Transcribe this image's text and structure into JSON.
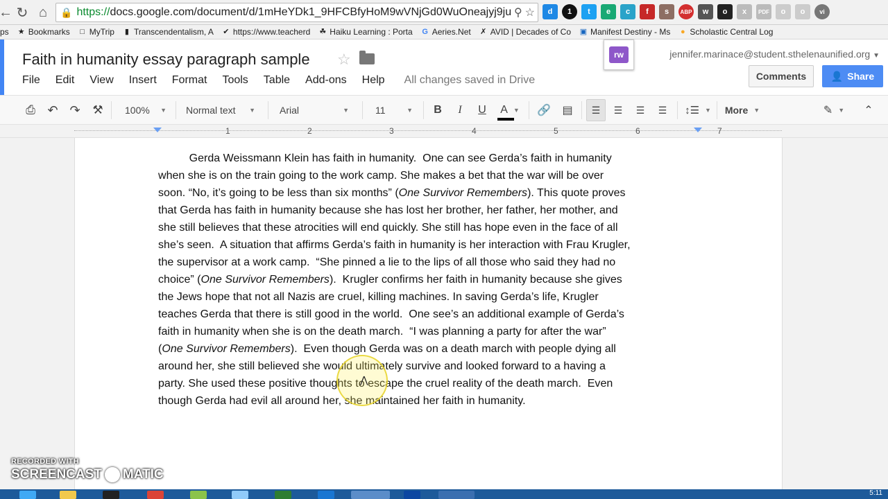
{
  "browser": {
    "url_scheme": "https://",
    "url_rest": "docs.google.com/document/d/1mHeYDk1_9HFCBfyHoM9wVNjGd0WuOneajyj9ju",
    "extensions": [
      "d",
      "1",
      "t",
      "e",
      "c",
      "f",
      "s",
      "ABP",
      "w",
      "o",
      "x",
      "PDF",
      "o",
      "o",
      "vi"
    ]
  },
  "bookmarks": {
    "cut": "ps",
    "items": [
      "Bookmarks",
      "MyTrip",
      "Transcendentalism, A",
      "https://www.teacherd",
      "Haiku Learning : Porta",
      "Aeries.Net",
      "AVID | Decades of Co",
      "Manifest Destiny - Ms",
      "Scholastic Central Log"
    ]
  },
  "doc": {
    "title": "Faith in humanity essay paragraph sample",
    "account": "jennifer.marinace@student.sthelenaunified.org",
    "comments_label": "Comments",
    "share_label": "Share",
    "addon_label": "rw",
    "saved_status": "All changes saved in Drive"
  },
  "menu": {
    "items": [
      "File",
      "Edit",
      "View",
      "Insert",
      "Format",
      "Tools",
      "Table",
      "Add-ons",
      "Help"
    ]
  },
  "toolbar": {
    "zoom": "100%",
    "style": "Normal text",
    "font": "Arial",
    "size": "11",
    "bold": "B",
    "italic": "I",
    "underline": "U",
    "text_color": "A",
    "more": "More"
  },
  "ruler": {
    "numbers": [
      "1",
      "2",
      "3",
      "4",
      "5",
      "6",
      "7"
    ]
  },
  "essay": {
    "lines": [
      "          Gerda Weissmann Klein has faith in humanity.  One can see Gerda’s faith in humanity",
      "when she is on the train going to the work camp. She makes a bet that the war will be over",
      "soon. “No, it’s going to be less than six months” (One Survivor Remembers). This quote proves",
      "that Gerda has faith in humanity because she has lost her brother, her father, her mother, and",
      "she still believes that these atrocities will end quickly. She still has hope even in the face of all",
      "she’s seen.  A situation that affirms Gerda’s faith in humanity is her interaction with Frau Krugler,",
      "the supervisor at a work camp.  “She pinned a lie to the lips of all those who said they had no",
      "choice” (One Survivor Remembers).  Krugler confirms her faith in humanity because she gives",
      "the Jews hope that not all Nazis are cruel, killing machines. In saving Gerda’s life, Krugler",
      "teaches Gerda that there is still good in the world.  One see’s an additional example of Gerda’s",
      "faith in humanity when she is on the death march.  “I was planning a party for after the war”",
      "(One Survivor Remembers).  Even though Gerda was on a death march with people dying all",
      "around her, she still believed she would ultimately survive and looked forward to a having a",
      "party. She used these positive thoughts to escape the cruel reality of the death march.  Even",
      "though Gerda had evil all around her, she maintained her faith in humanity."
    ]
  },
  "watermark": {
    "line1": "RECORDED WITH",
    "left": "SCREENCAST",
    "right": "MATIC"
  },
  "taskbar": {
    "clock": "5:11"
  },
  "colors": {
    "accent_blue": "#4285f4",
    "share_blue": "#4d8cf4",
    "addon_purple": "#8e57c9",
    "taskbar": "#1d5a9a"
  }
}
